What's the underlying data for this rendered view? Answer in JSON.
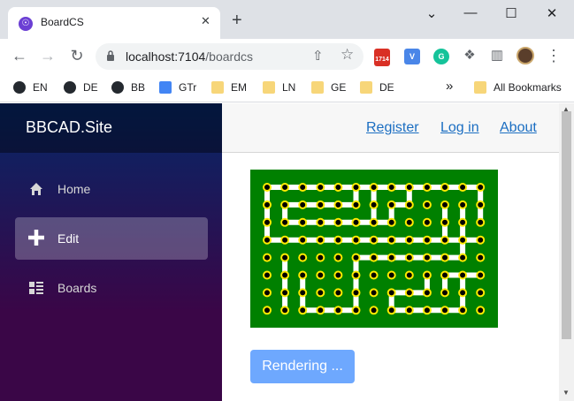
{
  "browser": {
    "tab_title": "BoardCS",
    "tab_favicon": "☉",
    "tab_close": "✕",
    "new_tab": "+",
    "url_host": "localhost:7104",
    "url_path": "/boardcs",
    "window": {
      "minimize": "—",
      "maximize": "☐",
      "close": "✕",
      "dropdown": "⌄"
    },
    "ext_badge": "1714",
    "ext_v": "V",
    "ext_g": "G",
    "more": "⋮",
    "back": "←",
    "forward": "→",
    "reload": "↻",
    "share_icon": "⇧",
    "star_icon": "☆",
    "puzzle_icon": "❖",
    "sidepanel_icon": "▥"
  },
  "bookmarks": {
    "items": [
      "EN",
      "DE",
      "BB",
      "GTr",
      "EM",
      "LN",
      "GE",
      "DE"
    ],
    "overflow": "»",
    "all": "All Bookmarks"
  },
  "sidebar": {
    "brand": "BBCAD.Site",
    "items": [
      {
        "label": "Home",
        "icon": "home-icon"
      },
      {
        "label": "Edit",
        "icon": "plus-icon"
      },
      {
        "label": "Boards",
        "icon": "list-icon"
      }
    ],
    "active": "Edit"
  },
  "top_row": {
    "links": [
      "Register",
      "Log in",
      "About"
    ]
  },
  "board": {
    "cols": 13,
    "rows": 8,
    "background": "#008000",
    "pad_color": "#ffeb00",
    "trace_color": "#ffffff",
    "traces": [
      [
        [
          0,
          0
        ],
        [
          12,
          0
        ]
      ],
      [
        [
          0,
          0
        ],
        [
          0,
          3
        ]
      ],
      [
        [
          0,
          3
        ],
        [
          12,
          3
        ]
      ],
      [
        [
          1,
          1
        ],
        [
          1,
          2
        ]
      ],
      [
        [
          1,
          1
        ],
        [
          3,
          1
        ]
      ],
      [
        [
          1,
          2
        ],
        [
          7,
          2
        ]
      ],
      [
        [
          3,
          1
        ],
        [
          5,
          1
        ]
      ],
      [
        [
          5,
          0
        ],
        [
          5,
          1
        ]
      ],
      [
        [
          6,
          0
        ],
        [
          6,
          2
        ]
      ],
      [
        [
          7,
          1
        ],
        [
          7,
          2
        ]
      ],
      [
        [
          7,
          1
        ],
        [
          8,
          1
        ]
      ],
      [
        [
          8,
          0
        ],
        [
          8,
          1
        ]
      ],
      [
        [
          10,
          1
        ],
        [
          10,
          3
        ]
      ],
      [
        [
          11,
          1
        ],
        [
          11,
          3
        ]
      ],
      [
        [
          12,
          0
        ],
        [
          12,
          2
        ]
      ],
      [
        [
          1,
          4
        ],
        [
          1,
          7
        ]
      ],
      [
        [
          2,
          5
        ],
        [
          2,
          7
        ]
      ],
      [
        [
          2,
          7
        ],
        [
          5,
          7
        ]
      ],
      [
        [
          5,
          4
        ],
        [
          5,
          7
        ]
      ],
      [
        [
          5,
          4
        ],
        [
          11,
          4
        ]
      ],
      [
        [
          11,
          3
        ],
        [
          11,
          4
        ]
      ],
      [
        [
          7,
          6
        ],
        [
          7,
          7
        ]
      ],
      [
        [
          7,
          6
        ],
        [
          9,
          6
        ]
      ],
      [
        [
          9,
          5
        ],
        [
          9,
          6
        ]
      ],
      [
        [
          7,
          7
        ],
        [
          11,
          7
        ]
      ],
      [
        [
          11,
          5
        ],
        [
          11,
          7
        ]
      ],
      [
        [
          10,
          5
        ],
        [
          12,
          5
        ]
      ],
      [
        [
          10,
          5
        ],
        [
          10,
          6
        ]
      ]
    ]
  },
  "render_button": "Rendering ...",
  "colors": {
    "sidebar_top": "#052767",
    "sidebar_bottom": "#3a0647",
    "link": "#1b6ec2",
    "button": "#6ea8fe"
  }
}
